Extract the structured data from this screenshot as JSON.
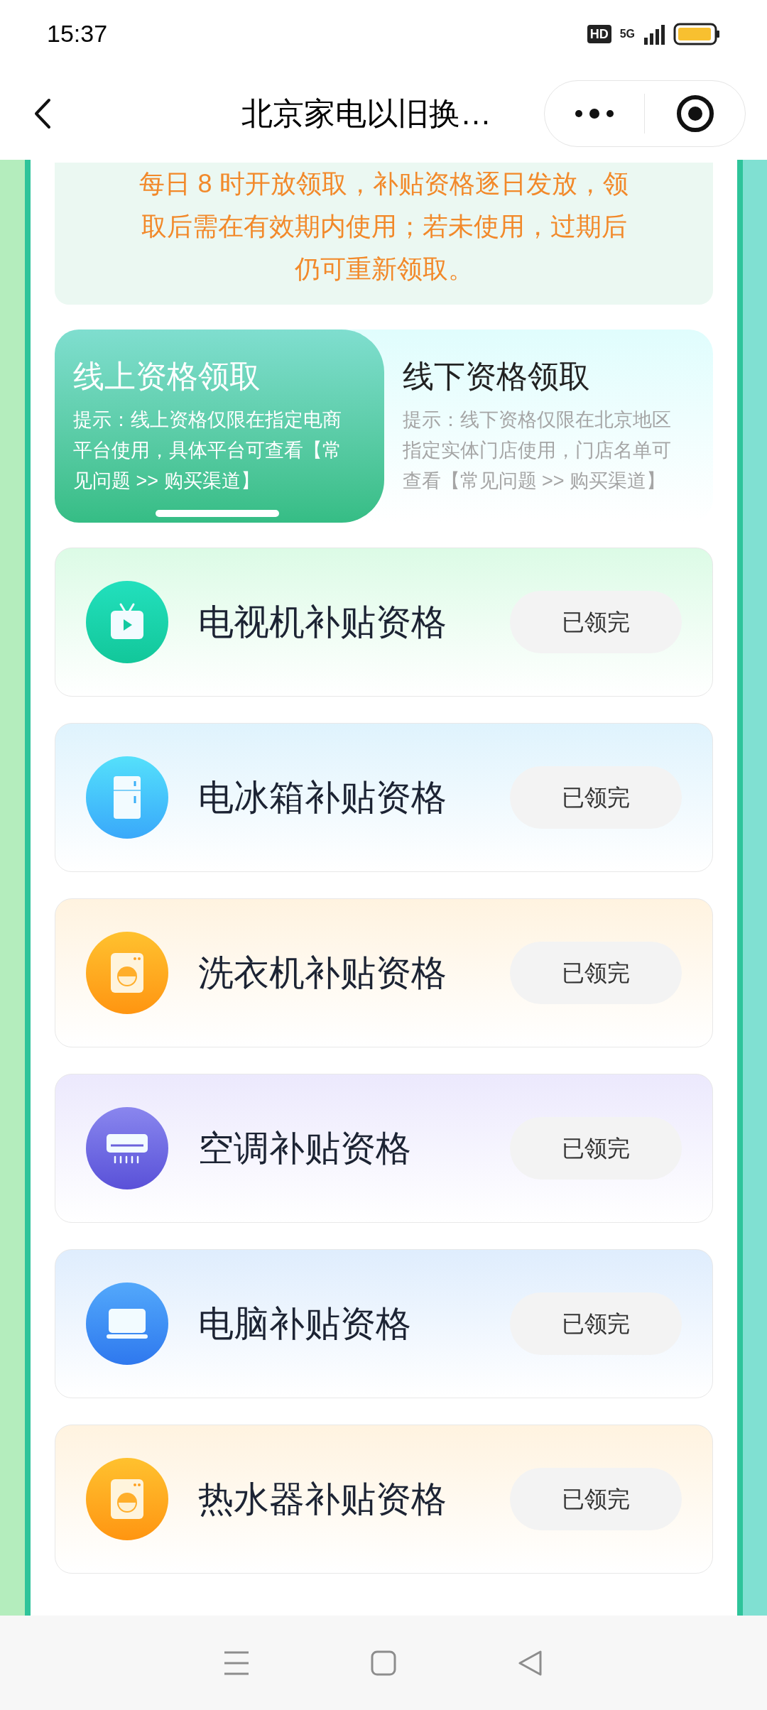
{
  "status_bar": {
    "time": "15:37",
    "hd": "HD",
    "network": "5G"
  },
  "header": {
    "title": "北京家电以旧换…"
  },
  "notice": {
    "lines": [
      "每日 8 时开放领取，补贴资格逐日发放，领",
      "取后需在有效期内使用；若未使用，过期后",
      "仍可重新领取。"
    ]
  },
  "tabs": [
    {
      "label": "线上资格领取",
      "hint": "提示：线上资格仅限在指定电商平台使用，具体平台可查看【常见问题 >> 购买渠道】",
      "selected": true
    },
    {
      "label": "线下资格领取",
      "hint": "提示：线下资格仅限在北京地区指定实体门店使用，门店名单可查看【常见问题 >> 购买渠道】",
      "selected": false
    }
  ],
  "subsidies": [
    {
      "kind": "tv",
      "title": "电视机补贴资格",
      "button": "已领完",
      "disabled": true
    },
    {
      "kind": "fridge",
      "title": "电冰箱补贴资格",
      "button": "已领完",
      "disabled": true
    },
    {
      "kind": "washer",
      "title": "洗衣机补贴资格",
      "button": "已领完",
      "disabled": true
    },
    {
      "kind": "ac",
      "title": "空调补贴资格",
      "button": "已领完",
      "disabled": true
    },
    {
      "kind": "computer",
      "title": "电脑补贴资格",
      "button": "已领完",
      "disabled": true
    },
    {
      "kind": "heater",
      "title": "热水器补贴资格",
      "button": "已领完",
      "disabled": true
    }
  ]
}
